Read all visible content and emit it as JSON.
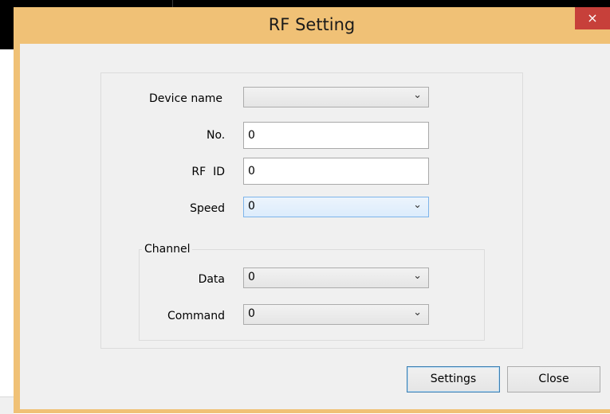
{
  "window": {
    "title": "RF Setting",
    "close_glyph": "×"
  },
  "form": {
    "device_name": {
      "label": "Device name",
      "value": ""
    },
    "number": {
      "label": "No.",
      "value": "0"
    },
    "rf_id": {
      "label": "RF  ID",
      "value": "0"
    },
    "speed": {
      "label": "Speed",
      "value": "0"
    }
  },
  "channel": {
    "title": "Channel",
    "data": {
      "label": "Data",
      "value": "0"
    },
    "command": {
      "label": "Command",
      "value": "0"
    }
  },
  "buttons": {
    "settings": "Settings",
    "close": "Close"
  },
  "icons": {
    "dropdown": "chevron-down-icon",
    "close": "close-icon"
  },
  "colors": {
    "title_bar": "#f0c176",
    "close_button": "#c7403a",
    "client_bg": "#f0f0f0"
  }
}
